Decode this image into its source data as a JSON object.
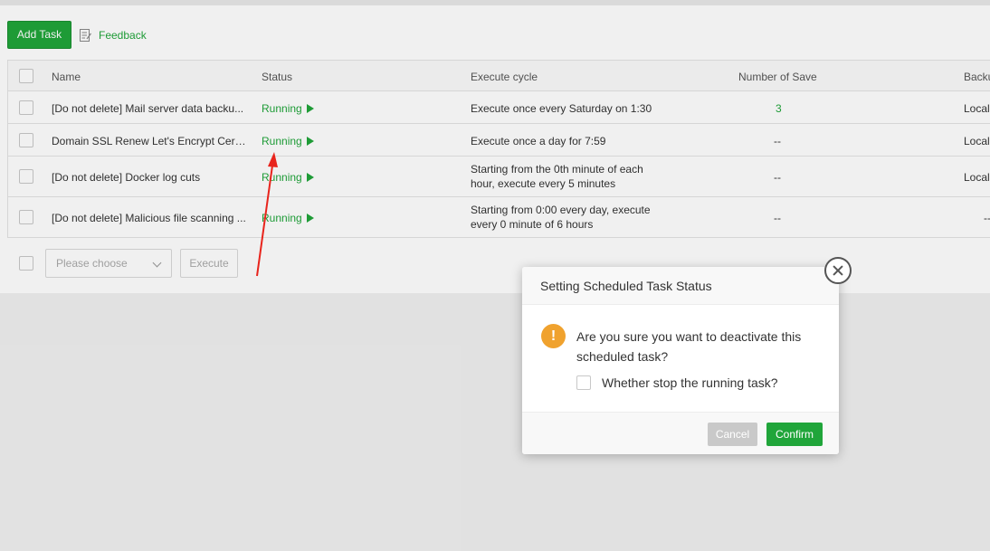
{
  "toolbar": {
    "add_task_label": "Add Task",
    "feedback_label": "Feedback"
  },
  "table": {
    "headers": {
      "name": "Name",
      "status": "Status",
      "cycle": "Execute cycle",
      "save": "Number of Save",
      "backup": "Backu"
    },
    "rows": [
      {
        "name": "[Do not delete] Mail server data backu...",
        "status": "Running",
        "cycle": "Execute once every Saturday on 1:30",
        "save": "3",
        "backup": "Local"
      },
      {
        "name": "Domain SSL Renew Let's Encrypt Certifi...",
        "status": "Running",
        "cycle": "Execute once a day for 7:59",
        "save": "--",
        "backup": "Local"
      },
      {
        "name": "[Do not delete] Docker log cuts",
        "status": "Running",
        "cycle": "Starting from the 0th minute of each hour, execute every 5 minutes",
        "save": "--",
        "backup": "Local"
      },
      {
        "name": "[Do not delete] Malicious file scanning ...",
        "status": "Running",
        "cycle": "Starting from 0:00 every day, execute every 0 minute of 6 hours",
        "save": "--",
        "backup": "--"
      }
    ]
  },
  "batch": {
    "select_placeholder": "Please choose",
    "execute_label": "Execute"
  },
  "modal": {
    "title": "Setting Scheduled Task Status",
    "message": "Are you sure you want to deactivate this scheduled task?",
    "option_label": "Whether stop the running task?",
    "cancel_label": "Cancel",
    "confirm_label": "Confirm",
    "warning_glyph": "!"
  },
  "colors": {
    "accent": "#20a53a",
    "warning": "#f0a22e",
    "annotation_arrow": "#e8241c"
  },
  "icons": {
    "feedback": "feedback-edit-icon",
    "play": "play-triangle-icon",
    "close": "close-circle-icon",
    "warning": "warning-icon"
  }
}
